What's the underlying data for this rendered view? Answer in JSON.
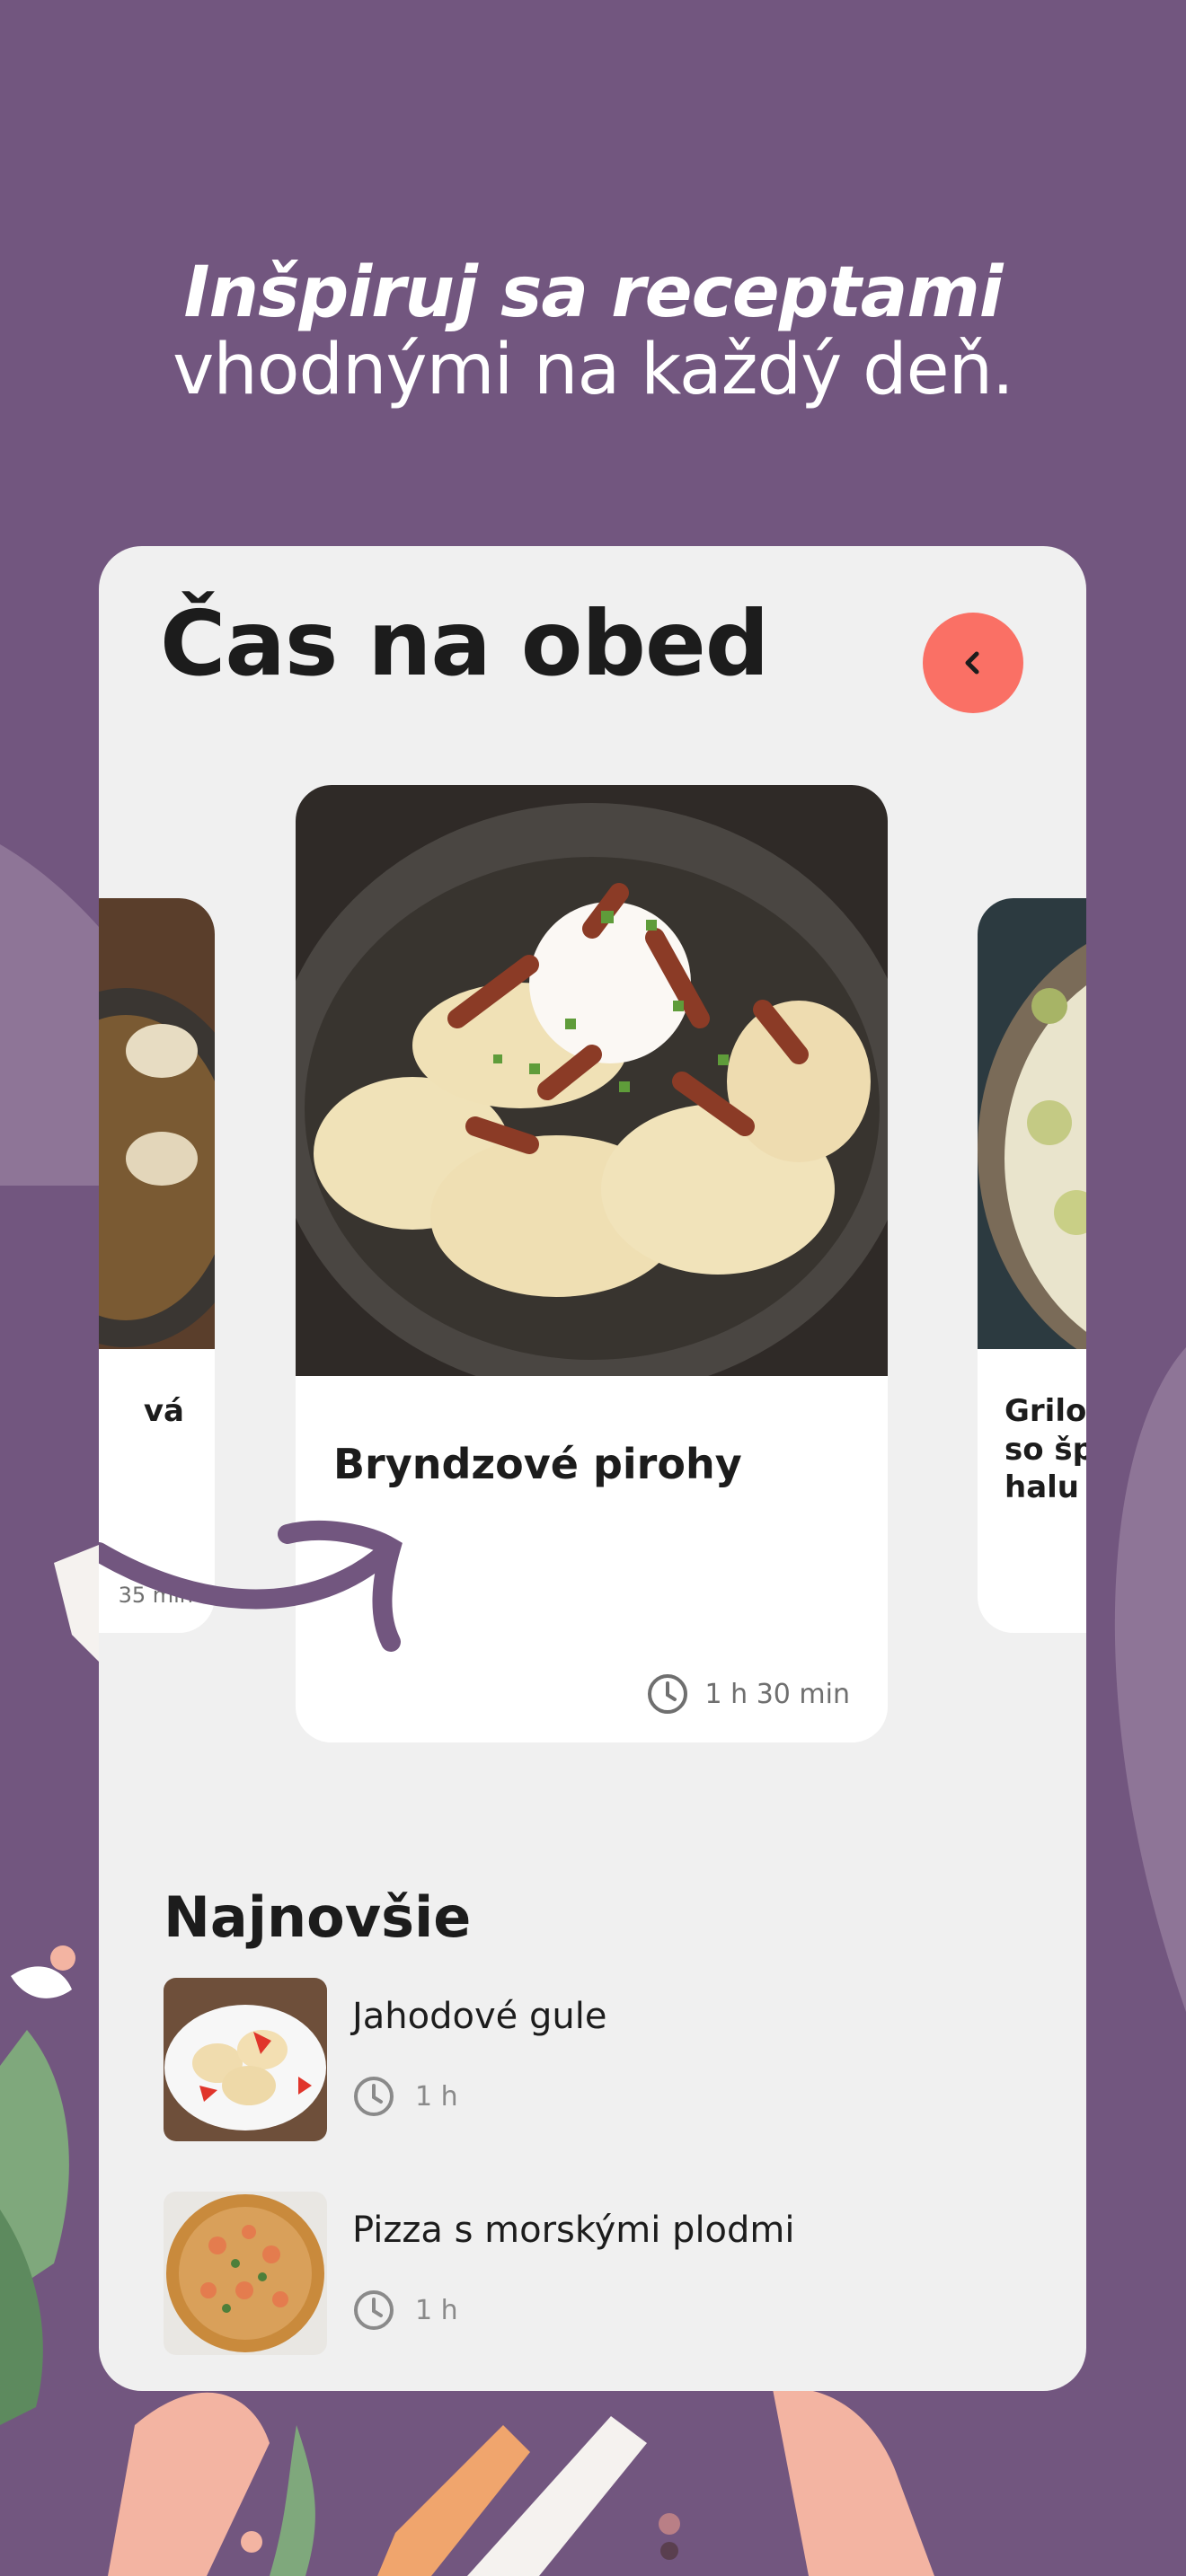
{
  "headline": {
    "line1": "Inšpiruj sa receptami",
    "line2": "vhodnými na každý deň."
  },
  "section": {
    "title": "Čas na obed"
  },
  "carousel": {
    "prev_card": {
      "title": "vá",
      "time": "35 min"
    },
    "current_card": {
      "title": "Bryndzové pirohy",
      "time": "1 h 30 min"
    },
    "next_card": {
      "title_line1": "Grilo",
      "title_line2": "so šp",
      "title_line3": "halu"
    }
  },
  "newest": {
    "title": "Najnovšie",
    "items": [
      {
        "name": "Jahodové gule",
        "time": "1 h"
      },
      {
        "name": "Pizza s morskými plodmi",
        "time": "1 h"
      }
    ]
  },
  "colors": {
    "background": "#72567f",
    "card": "#f0f0f0",
    "accent": "#fa7065",
    "text": "#1c1c1c"
  },
  "icons": [
    "chevron-left-icon",
    "clock-icon",
    "curved-arrow-decoration"
  ]
}
